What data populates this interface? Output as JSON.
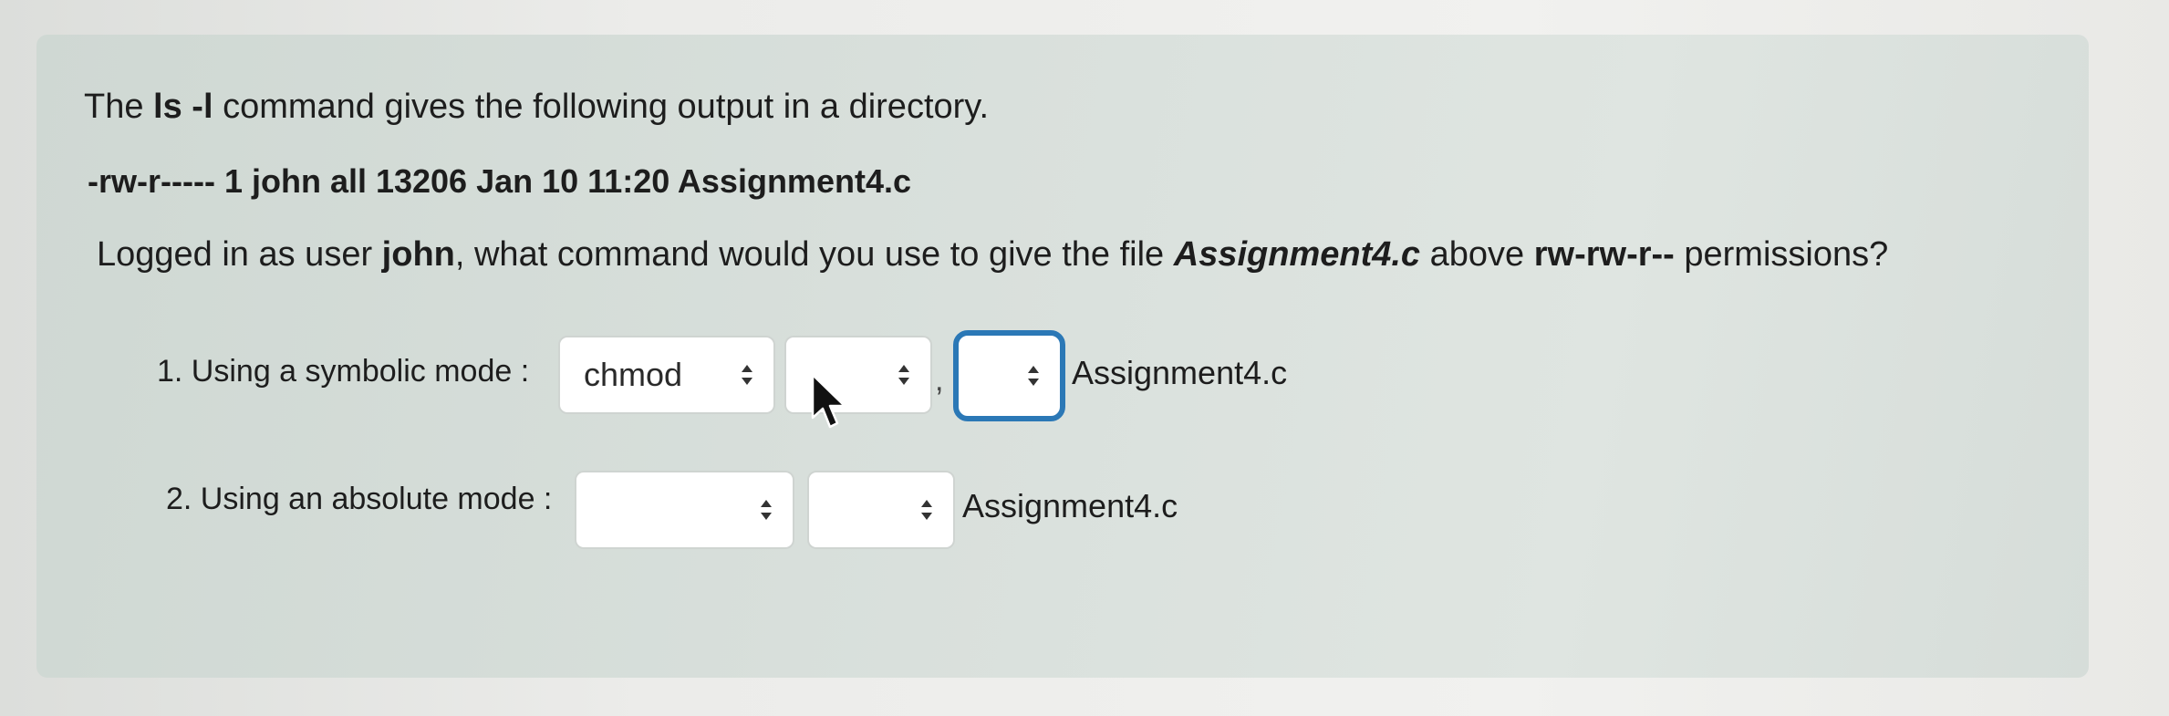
{
  "question": {
    "line1": {
      "pre": "The ",
      "command": "ls -l",
      "post": " command gives the following output in a directory."
    },
    "listing": "-rw-r----- 1 john all 13206 Jan 10 11:20 Assignment4.c",
    "prompt": {
      "pre": "Logged in as user ",
      "user": "john",
      "mid": ", what command would you use to give the file ",
      "file": "Assignment4.c",
      "mid2": " above ",
      "perms": "rw-rw-r--",
      "post": " permissions?"
    }
  },
  "symbolic": {
    "label": "1. Using a symbolic mode :",
    "command_select_value": "chmod",
    "who_select_value": "",
    "separator": ",",
    "perm_select_value": "",
    "filename": "Assignment4.c"
  },
  "absolute": {
    "label": "2. Using an absolute mode :",
    "first_select_value": "",
    "second_select_value": "",
    "filename": "Assignment4.c"
  },
  "colors": {
    "card_background": "#d9e0dc",
    "focus_ring": "#2b78b6",
    "select_background": "#ffffff"
  },
  "icons": {
    "select_arrows": "updown-caret-icon",
    "pointer": "mouse-pointer-icon"
  }
}
